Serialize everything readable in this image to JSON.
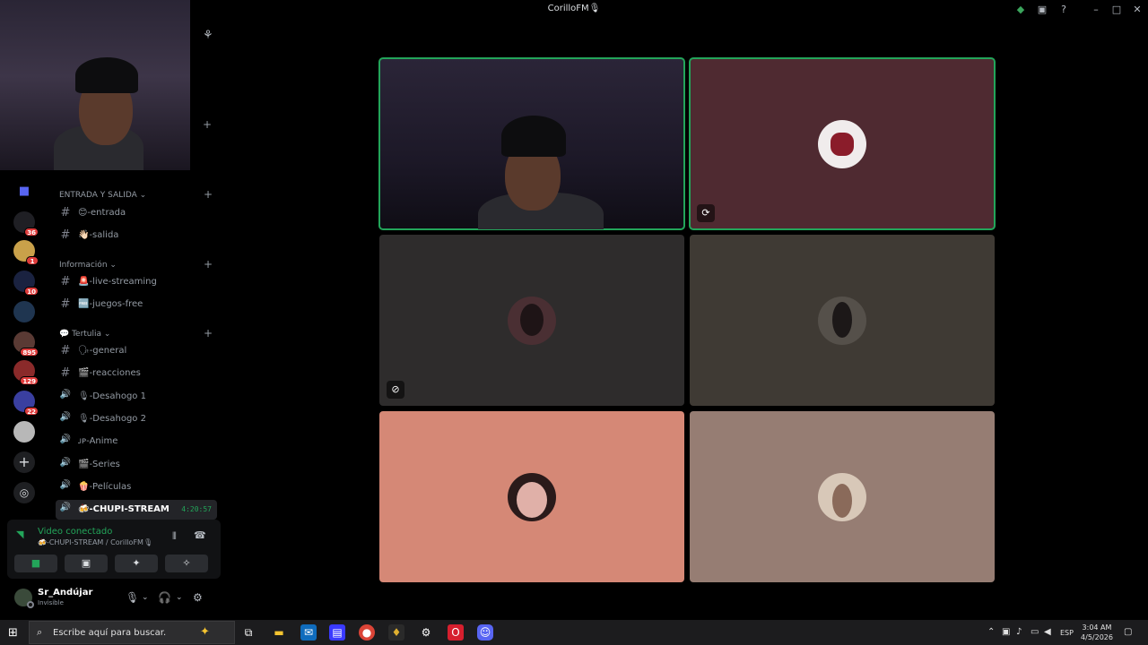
{
  "window": {
    "title": "CorilloFM🎙",
    "minimize_glyph": "–",
    "maximize_glyph": "□",
    "close_glyph": "✕"
  },
  "servers": [
    {
      "name": "home",
      "badge": ""
    },
    {
      "name": "server-1",
      "badge": "36"
    },
    {
      "name": "server-2",
      "badge": "1"
    },
    {
      "name": "server-3",
      "badge": "10"
    },
    {
      "name": "server-4",
      "badge": ""
    },
    {
      "name": "server-5",
      "badge": "895"
    },
    {
      "name": "server-6",
      "badge": "129"
    },
    {
      "name": "server-7",
      "badge": "22"
    },
    {
      "name": "server-8",
      "badge": ""
    }
  ],
  "categories": [
    {
      "label": "ENTRADA Y SALIDA ⌄"
    },
    {
      "label": "Información ⌄"
    },
    {
      "label": "💬 Tertulia ⌄"
    }
  ],
  "channels": [
    {
      "name": "😊-entrada",
      "glyph": "#"
    },
    {
      "name": "👋🏻-salida",
      "glyph": "#"
    },
    {
      "name": "🚨-live-streaming",
      "glyph": "#"
    },
    {
      "name": "🆓-juegos-free",
      "glyph": "#"
    },
    {
      "name": "🗣-general",
      "glyph": "#"
    },
    {
      "name": "🎬-reacciones",
      "glyph": "#"
    },
    {
      "name": "🎙-Desahogo 1",
      "glyph": "🔊"
    },
    {
      "name": "🎙-Desahogo 2",
      "glyph": "🔊"
    },
    {
      "name": "ᴊᴘ-Anime",
      "glyph": "🔊"
    },
    {
      "name": "🎬-Series",
      "glyph": "🔊"
    },
    {
      "name": "🍿-Películas",
      "glyph": "🔊"
    },
    {
      "name": "🍻-CHUPI-STREAM",
      "glyph": "🔊",
      "time": "4:20:57"
    }
  ],
  "voice": {
    "status": "Video conectado",
    "channel": "🍻-CHUPI-STREAM / CorilloFM🎙"
  },
  "user": {
    "name": "Sr_Andújar",
    "status": "Invisible"
  },
  "tiles": [
    {
      "bg": "#1c1827",
      "speaking": true
    },
    {
      "bg": "#4f2a31",
      "speaking": true
    },
    {
      "bg": "#2e2c2c",
      "speaking": false
    },
    {
      "bg": "#3f3a34",
      "speaking": false
    },
    {
      "bg": "#d58876",
      "speaking": false
    },
    {
      "bg": "#967d73",
      "speaking": false
    }
  ],
  "taskbar": {
    "search_placeholder": "Escribe aquí para buscar.",
    "language": "ESP",
    "time": "3:04 AM",
    "date": "4/5/2026"
  },
  "colors": {
    "accent_green": "#23a55a",
    "badge_red": "#e03c3c",
    "background": "#000000"
  }
}
